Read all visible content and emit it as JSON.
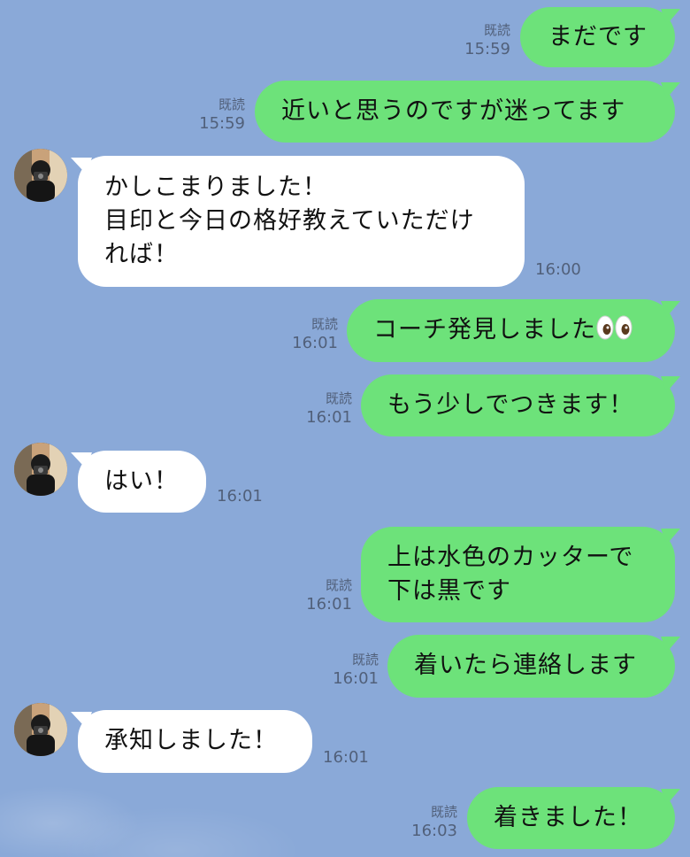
{
  "messages": [
    {
      "id": "m1",
      "side": "out",
      "lines": [
        "まだです"
      ],
      "read": "既読",
      "time": "15:59"
    },
    {
      "id": "m2",
      "side": "out",
      "lines": [
        "近いと思うのですが迷ってます"
      ],
      "read": "既読",
      "time": "15:59"
    },
    {
      "id": "m3",
      "side": "in",
      "lines": [
        "かしこまりました！",
        "目印と今日の格好教えていただけ",
        "れば！"
      ],
      "time": "16:00"
    },
    {
      "id": "m4",
      "side": "out",
      "lines": [
        "コーチ発見しました"
      ],
      "emoji": "eyes",
      "read": "既読",
      "time": "16:01"
    },
    {
      "id": "m5",
      "side": "out",
      "lines": [
        "もう少しでつきます！"
      ],
      "read": "既読",
      "time": "16:01"
    },
    {
      "id": "m6",
      "side": "in",
      "lines": [
        "はい！"
      ],
      "time": "16:01"
    },
    {
      "id": "m7",
      "side": "out",
      "lines": [
        "上は水色のカッターで",
        "下は黒です"
      ],
      "read": "既読",
      "time": "16:01"
    },
    {
      "id": "m8",
      "side": "out",
      "lines": [
        "着いたら連絡します"
      ],
      "read": "既読",
      "time": "16:01"
    },
    {
      "id": "m9",
      "side": "in",
      "lines": [
        "承知しました！"
      ],
      "time": "16:01"
    },
    {
      "id": "m10",
      "side": "out",
      "lines": [
        "着きました！"
      ],
      "read": "既読",
      "time": "16:03"
    }
  ],
  "colors": {
    "background": "#8aa9d8",
    "outgoing_bubble": "#6de27a",
    "incoming_bubble": "#ffffff",
    "meta_text": "#51607a"
  },
  "icons": {
    "avatar": "contact-avatar",
    "emoji": "eyes-emoji"
  }
}
